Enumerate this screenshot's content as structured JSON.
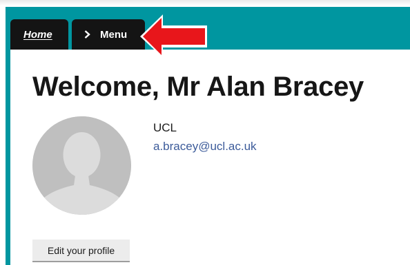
{
  "nav": {
    "home_label": "Home",
    "menu_label": "Menu"
  },
  "profile": {
    "welcome_title": "Welcome, Mr Alan Bracey",
    "organisation": "UCL",
    "email": "a.bracey@ucl.ac.uk",
    "edit_button_label": "Edit your profile"
  },
  "icons": {
    "menu_chevron": "chevron-right-icon",
    "avatar": "user-silhouette-icon",
    "annotation": "red-arrow-icon"
  },
  "colors": {
    "header_teal": "#0096a0",
    "tab_black": "#141414",
    "link_blue": "#3c5b9a",
    "annotation_red": "#e8161b"
  }
}
